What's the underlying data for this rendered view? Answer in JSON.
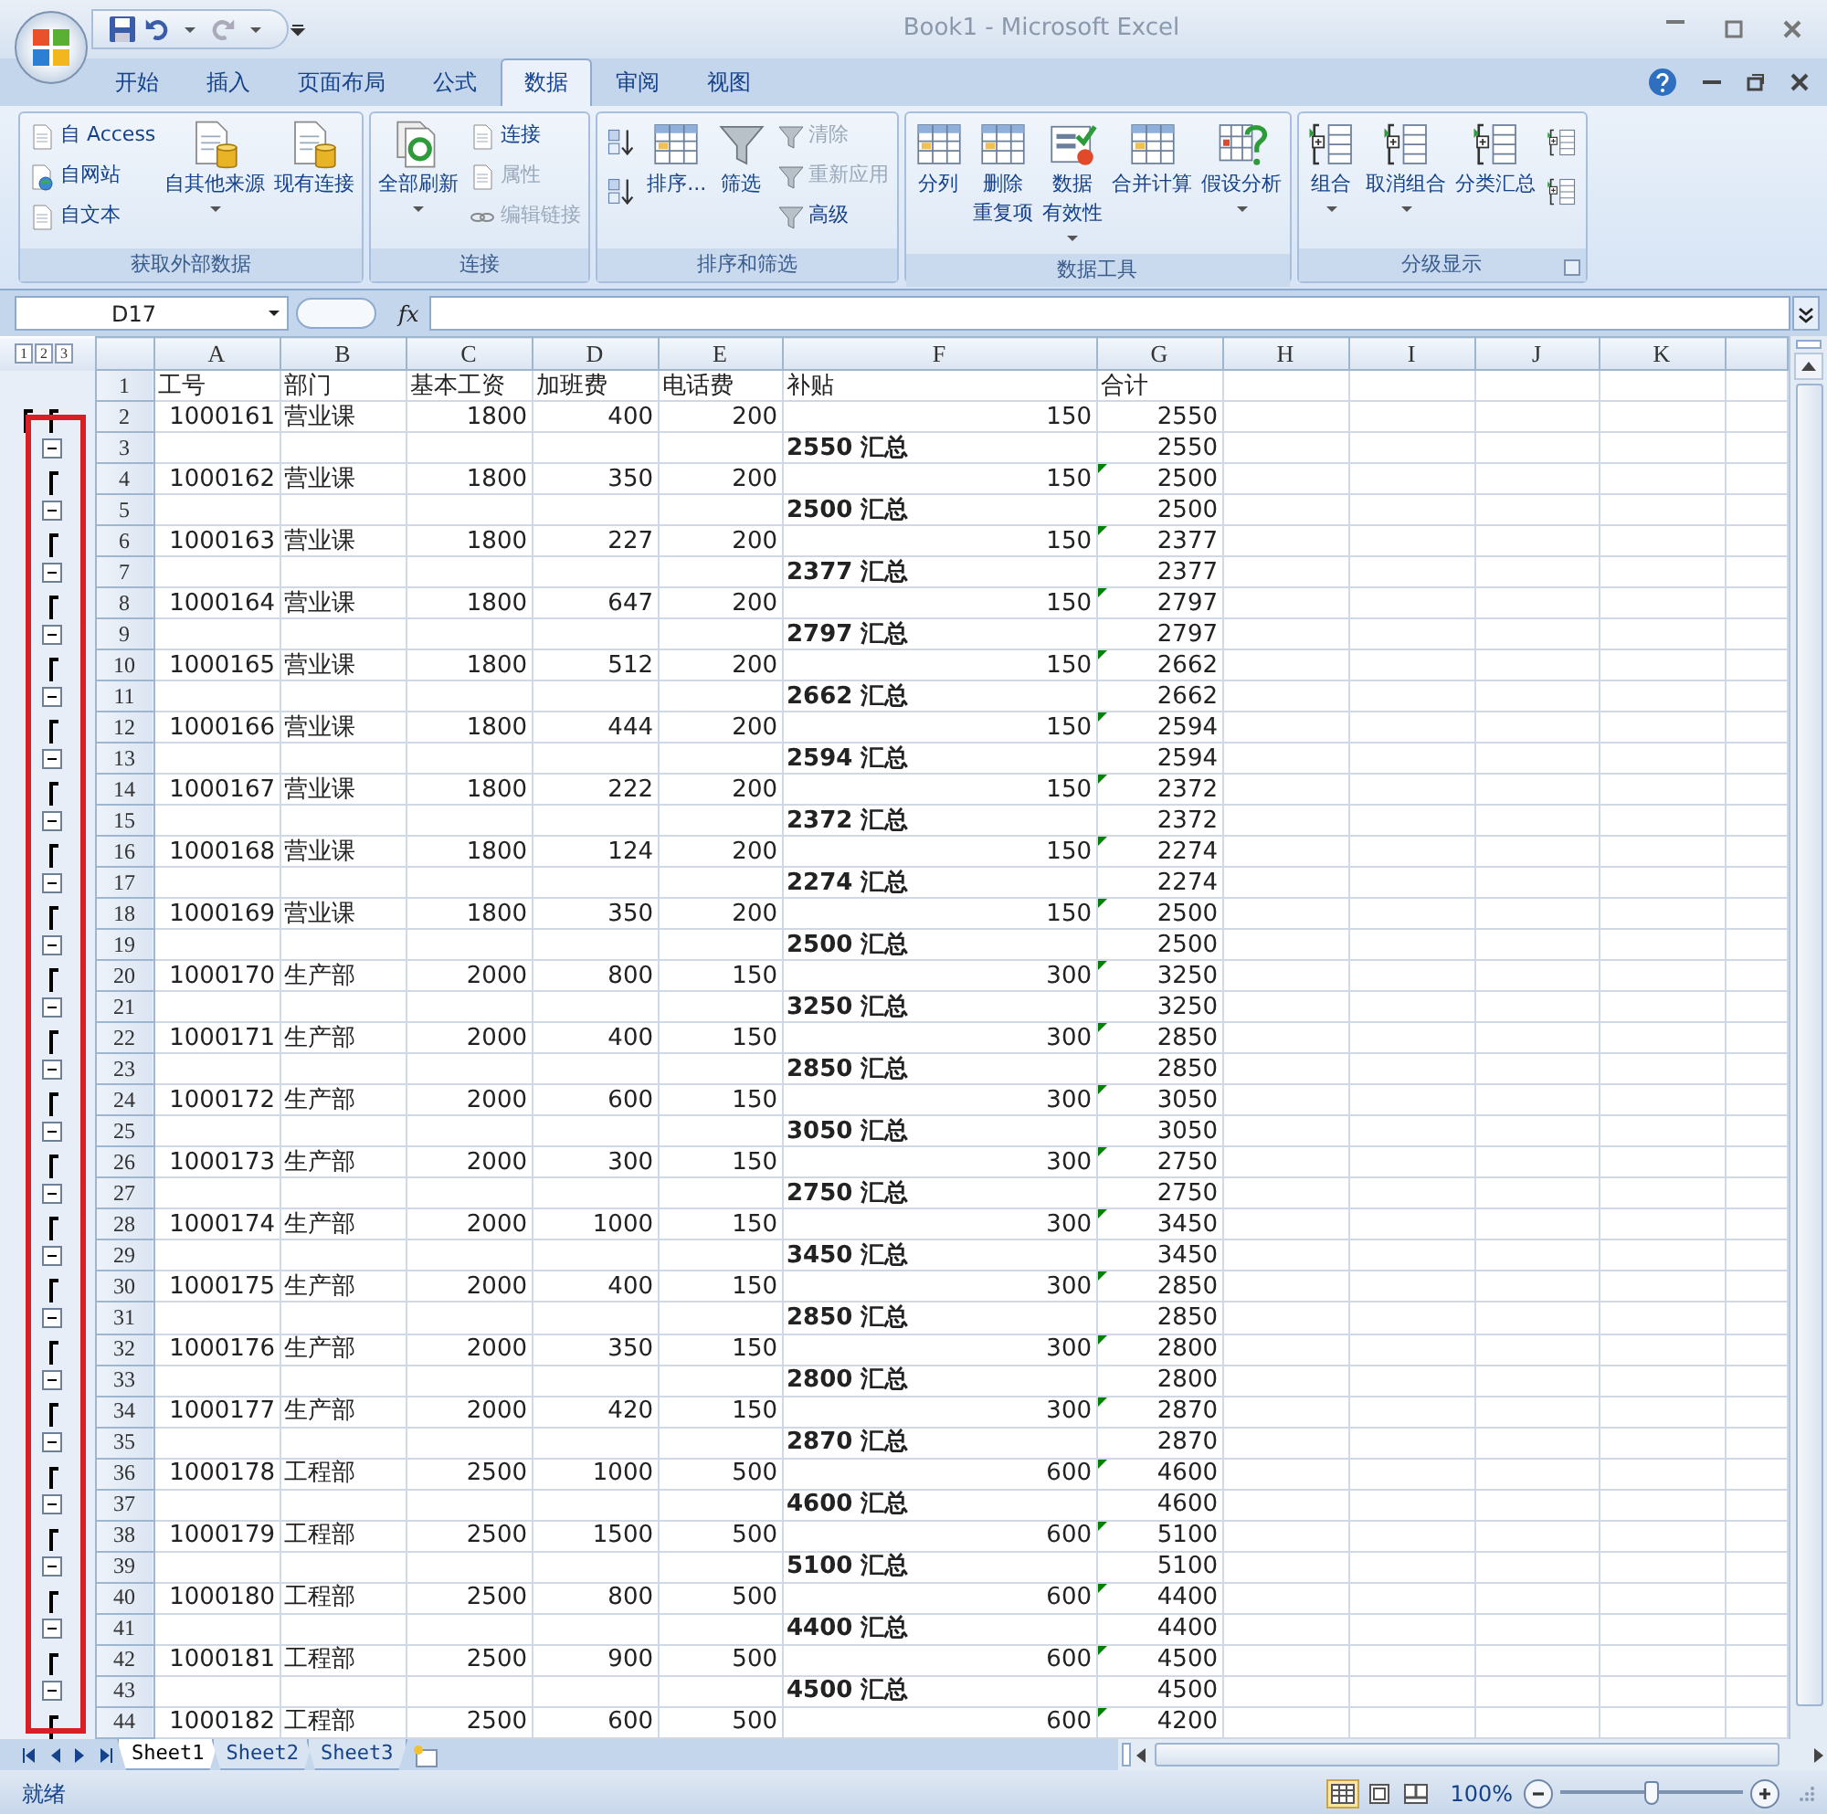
{
  "window": {
    "title": "Book1 - Microsoft Excel"
  },
  "tabs": [
    {
      "label": "开始",
      "selected": false
    },
    {
      "label": "插入",
      "selected": false
    },
    {
      "label": "页面布局",
      "selected": false
    },
    {
      "label": "公式",
      "selected": false
    },
    {
      "label": "数据",
      "selected": true
    },
    {
      "label": "审阅",
      "selected": false
    },
    {
      "label": "视图",
      "selected": false
    }
  ],
  "ribbon": [
    {
      "title": "获取外部数据",
      "columns": [
        [
          {
            "kind": "small",
            "label": "自 Access",
            "disabled": false
          },
          {
            "kind": "small",
            "label": "自网站",
            "disabled": false
          },
          {
            "kind": "small",
            "label": "自文本",
            "disabled": false
          }
        ],
        [
          {
            "kind": "large",
            "lines": [
              "自其他来源"
            ],
            "dropdown": true
          }
        ],
        [
          {
            "kind": "large",
            "lines": [
              "现有连接"
            ],
            "dropdown": false
          }
        ]
      ]
    },
    {
      "title": "连接",
      "columns": [
        [
          {
            "kind": "large",
            "lines": [
              "全部刷新"
            ],
            "dropdown": true
          }
        ],
        [
          {
            "kind": "small",
            "label": "连接",
            "disabled": false
          },
          {
            "kind": "small",
            "label": "属性",
            "disabled": true
          },
          {
            "kind": "small",
            "label": "编辑链接",
            "disabled": true
          }
        ]
      ]
    },
    {
      "title": "排序和筛选",
      "columns": [
        [
          {
            "kind": "icon"
          },
          {
            "kind": "icon"
          }
        ],
        [
          {
            "kind": "large",
            "lines": [
              "排序..."
            ],
            "dropdown": false
          }
        ],
        [
          {
            "kind": "large",
            "lines": [
              "筛选"
            ],
            "dropdown": false
          }
        ],
        [
          {
            "kind": "small",
            "label": "清除",
            "disabled": true
          },
          {
            "kind": "small",
            "label": "重新应用",
            "disabled": true
          },
          {
            "kind": "small",
            "label": "高级",
            "disabled": false
          }
        ]
      ]
    },
    {
      "title": "数据工具",
      "columns": [
        [
          {
            "kind": "large",
            "lines": [
              "分列"
            ],
            "dropdown": false
          }
        ],
        [
          {
            "kind": "large",
            "lines": [
              "删除",
              "重复项"
            ],
            "dropdown": false
          }
        ],
        [
          {
            "kind": "large",
            "lines": [
              "数据",
              "有效性"
            ],
            "dropdown": true
          }
        ],
        [
          {
            "kind": "large",
            "lines": [
              "合并计算"
            ],
            "dropdown": false
          }
        ],
        [
          {
            "kind": "large",
            "lines": [
              "假设分析"
            ],
            "dropdown": true
          }
        ]
      ]
    },
    {
      "title": "分级显示",
      "launcher": true,
      "columns": [
        [
          {
            "kind": "large",
            "lines": [
              "组合"
            ],
            "dropdown": true
          }
        ],
        [
          {
            "kind": "large",
            "lines": [
              "取消组合"
            ],
            "dropdown": true
          }
        ],
        [
          {
            "kind": "large",
            "lines": [
              "分类汇总"
            ],
            "dropdown": false
          }
        ],
        [
          {
            "kind": "icon"
          },
          {
            "kind": "icon"
          }
        ]
      ]
    }
  ],
  "formula_bar": {
    "name_box": "D17",
    "fx": "fx"
  },
  "sheet": {
    "outline_levels": [
      "1",
      "2",
      "3"
    ],
    "columns": [
      "A",
      "B",
      "C",
      "D",
      "E",
      "F",
      "G",
      "H",
      "I",
      "J",
      "K"
    ],
    "rows": [
      {
        "n": "1",
        "kind": "header",
        "cells": [
          "工号",
          "部门",
          "基本工资",
          "加班费",
          "电话费",
          "补贴",
          "合计"
        ]
      },
      {
        "n": "2",
        "kind": "data",
        "cells": [
          "1000161",
          "营业课",
          "1800",
          "400",
          "200",
          "150",
          "2550"
        ],
        "flag": false
      },
      {
        "n": "3",
        "kind": "subtotal",
        "label": "2550 汇总",
        "total": "2550",
        "expanded": true
      },
      {
        "n": "4",
        "kind": "data",
        "cells": [
          "1000162",
          "营业课",
          "1800",
          "350",
          "200",
          "150",
          "2500"
        ],
        "flag": true
      },
      {
        "n": "5",
        "kind": "subtotal",
        "label": "2500 汇总",
        "total": "2500",
        "expanded": true
      },
      {
        "n": "6",
        "kind": "data",
        "cells": [
          "1000163",
          "营业课",
          "1800",
          "227",
          "200",
          "150",
          "2377"
        ],
        "flag": true
      },
      {
        "n": "7",
        "kind": "subtotal",
        "label": "2377 汇总",
        "total": "2377",
        "expanded": true
      },
      {
        "n": "8",
        "kind": "data",
        "cells": [
          "1000164",
          "营业课",
          "1800",
          "647",
          "200",
          "150",
          "2797"
        ],
        "flag": true
      },
      {
        "n": "9",
        "kind": "subtotal",
        "label": "2797 汇总",
        "total": "2797",
        "expanded": true
      },
      {
        "n": "10",
        "kind": "data",
        "cells": [
          "1000165",
          "营业课",
          "1800",
          "512",
          "200",
          "150",
          "2662"
        ],
        "flag": true
      },
      {
        "n": "11",
        "kind": "subtotal",
        "label": "2662 汇总",
        "total": "2662",
        "expanded": true
      },
      {
        "n": "12",
        "kind": "data",
        "cells": [
          "1000166",
          "营业课",
          "1800",
          "444",
          "200",
          "150",
          "2594"
        ],
        "flag": true
      },
      {
        "n": "13",
        "kind": "subtotal",
        "label": "2594 汇总",
        "total": "2594",
        "expanded": true
      },
      {
        "n": "14",
        "kind": "data",
        "cells": [
          "1000167",
          "营业课",
          "1800",
          "222",
          "200",
          "150",
          "2372"
        ],
        "flag": true
      },
      {
        "n": "15",
        "kind": "subtotal",
        "label": "2372 汇总",
        "total": "2372",
        "expanded": true
      },
      {
        "n": "16",
        "kind": "data",
        "cells": [
          "1000168",
          "营业课",
          "1800",
          "124",
          "200",
          "150",
          "2274"
        ],
        "flag": true
      },
      {
        "n": "17",
        "kind": "subtotal",
        "label": "2274 汇总",
        "total": "2274",
        "expanded": true
      },
      {
        "n": "18",
        "kind": "data",
        "cells": [
          "1000169",
          "营业课",
          "1800",
          "350",
          "200",
          "150",
          "2500"
        ],
        "flag": true
      },
      {
        "n": "19",
        "kind": "subtotal",
        "label": "2500 汇总",
        "total": "2500",
        "expanded": true
      },
      {
        "n": "20",
        "kind": "data",
        "cells": [
          "1000170",
          "生产部",
          "2000",
          "800",
          "150",
          "300",
          "3250"
        ],
        "flag": true
      },
      {
        "n": "21",
        "kind": "subtotal",
        "label": "3250 汇总",
        "total": "3250",
        "expanded": true
      },
      {
        "n": "22",
        "kind": "data",
        "cells": [
          "1000171",
          "生产部",
          "2000",
          "400",
          "150",
          "300",
          "2850"
        ],
        "flag": true
      },
      {
        "n": "23",
        "kind": "subtotal",
        "label": "2850 汇总",
        "total": "2850",
        "expanded": true
      },
      {
        "n": "24",
        "kind": "data",
        "cells": [
          "1000172",
          "生产部",
          "2000",
          "600",
          "150",
          "300",
          "3050"
        ],
        "flag": true
      },
      {
        "n": "25",
        "kind": "subtotal",
        "label": "3050 汇总",
        "total": "3050",
        "expanded": true
      },
      {
        "n": "26",
        "kind": "data",
        "cells": [
          "1000173",
          "生产部",
          "2000",
          "300",
          "150",
          "300",
          "2750"
        ],
        "flag": true
      },
      {
        "n": "27",
        "kind": "subtotal",
        "label": "2750 汇总",
        "total": "2750",
        "expanded": true
      },
      {
        "n": "28",
        "kind": "data",
        "cells": [
          "1000174",
          "生产部",
          "2000",
          "1000",
          "150",
          "300",
          "3450"
        ],
        "flag": true
      },
      {
        "n": "29",
        "kind": "subtotal",
        "label": "3450 汇总",
        "total": "3450",
        "expanded": true
      },
      {
        "n": "30",
        "kind": "data",
        "cells": [
          "1000175",
          "生产部",
          "2000",
          "400",
          "150",
          "300",
          "2850"
        ],
        "flag": true
      },
      {
        "n": "31",
        "kind": "subtotal",
        "label": "2850 汇总",
        "total": "2850",
        "expanded": true
      },
      {
        "n": "32",
        "kind": "data",
        "cells": [
          "1000176",
          "生产部",
          "2000",
          "350",
          "150",
          "300",
          "2800"
        ],
        "flag": true
      },
      {
        "n": "33",
        "kind": "subtotal",
        "label": "2800 汇总",
        "total": "2800",
        "expanded": true
      },
      {
        "n": "34",
        "kind": "data",
        "cells": [
          "1000177",
          "生产部",
          "2000",
          "420",
          "150",
          "300",
          "2870"
        ],
        "flag": true
      },
      {
        "n": "35",
        "kind": "subtotal",
        "label": "2870 汇总",
        "total": "2870",
        "expanded": true
      },
      {
        "n": "36",
        "kind": "data",
        "cells": [
          "1000178",
          "工程部",
          "2500",
          "1000",
          "500",
          "600",
          "4600"
        ],
        "flag": true
      },
      {
        "n": "37",
        "kind": "subtotal",
        "label": "4600 汇总",
        "total": "4600",
        "expanded": true
      },
      {
        "n": "38",
        "kind": "data",
        "cells": [
          "1000179",
          "工程部",
          "2500",
          "1500",
          "500",
          "600",
          "5100"
        ],
        "flag": true
      },
      {
        "n": "39",
        "kind": "subtotal",
        "label": "5100 汇总",
        "total": "5100",
        "expanded": true
      },
      {
        "n": "40",
        "kind": "data",
        "cells": [
          "1000180",
          "工程部",
          "2500",
          "800",
          "500",
          "600",
          "4400"
        ],
        "flag": true
      },
      {
        "n": "41",
        "kind": "subtotal",
        "label": "4400 汇总",
        "total": "4400",
        "expanded": true
      },
      {
        "n": "42",
        "kind": "data",
        "cells": [
          "1000181",
          "工程部",
          "2500",
          "900",
          "500",
          "600",
          "4500"
        ],
        "flag": true
      },
      {
        "n": "43",
        "kind": "subtotal",
        "label": "4500 汇总",
        "total": "4500",
        "expanded": true
      },
      {
        "n": "44",
        "kind": "data",
        "cells": [
          "1000182",
          "工程部",
          "2500",
          "600",
          "500",
          "600",
          "4200"
        ],
        "flag": true
      }
    ]
  },
  "sheet_tabs": [
    {
      "label": "Sheet1",
      "selected": true
    },
    {
      "label": "Sheet2",
      "selected": false
    },
    {
      "label": "Sheet3",
      "selected": false
    }
  ],
  "status_bar": {
    "text": "就绪",
    "views": [
      {
        "selected": true
      },
      {
        "selected": false
      },
      {
        "selected": false
      }
    ],
    "zoom": "100%",
    "zoom_slider": {
      "level": 0.5
    }
  }
}
